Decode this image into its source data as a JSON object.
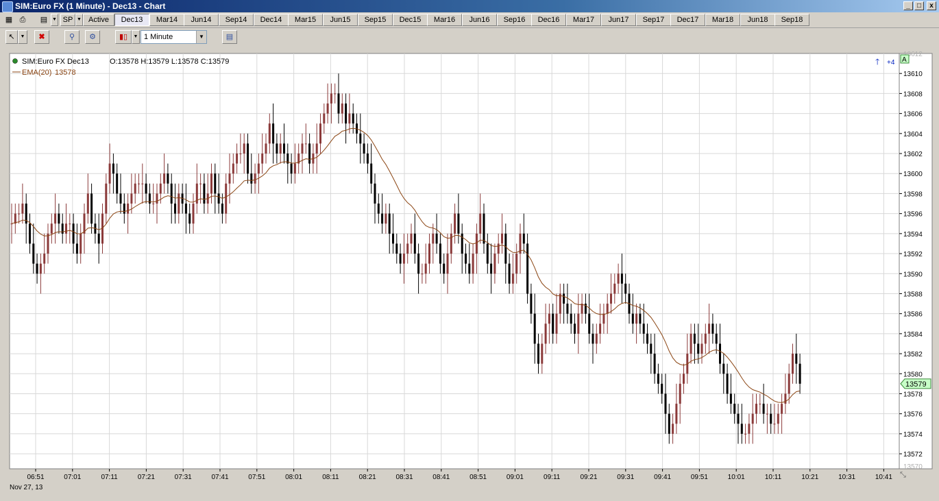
{
  "window": {
    "title": "SIM:Euro FX (1 Minute) - Dec13 - Chart",
    "minimize_glyph": "_",
    "maximize_glyph": "□",
    "close_glyph": "x"
  },
  "toolbar": {
    "instrument": "SP",
    "tabs": [
      "Active",
      "Dec13",
      "Mar14",
      "Jun14",
      "Sep14",
      "Dec14",
      "Mar15",
      "Jun15",
      "Sep15",
      "Dec15",
      "Mar16",
      "Jun16",
      "Sep16",
      "Dec16",
      "Mar17",
      "Jun17",
      "Sep17",
      "Dec17",
      "Mar18",
      "Jun18",
      "Sep18"
    ],
    "selected_tab": "Dec13",
    "timeframe": "1 Minute"
  },
  "colors": {
    "up_bar": "#8b3a3a",
    "down_bar": "#000000",
    "ema_line": "#8b4513",
    "grid": "#d8d8d8",
    "price_marker_bg": "#c8ffc8",
    "price_marker_border": "#3a8a3a"
  },
  "chart_data": {
    "type": "candlestick",
    "instrument_label": "SIM:Euro FX Dec13",
    "ohlc_label": "O:13578 H:13579 L:13578 C:13579",
    "indicator_label": "EMA(20)",
    "indicator_value": "13578",
    "last_price_label": "13579",
    "last_price": 13579,
    "scroll_label": "+4",
    "axis_button": "A",
    "date_label": "Nov 27, 13",
    "ylim": [
      13570.5,
      13612.0
    ],
    "ytick_values": [
      13572,
      13574,
      13576,
      13578,
      13580,
      13582,
      13584,
      13586,
      13588,
      13590,
      13592,
      13594,
      13596,
      13598,
      13600,
      13602,
      13604,
      13606,
      13608,
      13610
    ],
    "ytick_labels": [
      "13572",
      "13574",
      "13576",
      "13578",
      "13580",
      "13582",
      "13584",
      "13586",
      "13588",
      "13590",
      "13592",
      "13594",
      "13596",
      "13598",
      "13600",
      "13602",
      "13604",
      "13606",
      "13608",
      "13610"
    ],
    "ytick_top_label": "13612",
    "ytick_bottom_label": "13570",
    "xtick_labels": [
      "06:51",
      "07:01",
      "07:11",
      "07:21",
      "07:31",
      "07:41",
      "07:51",
      "08:01",
      "08:11",
      "08:21",
      "08:31",
      "08:41",
      "08:51",
      "09:01",
      "09:11",
      "09:21",
      "09:31",
      "09:41",
      "09:51",
      "10:01",
      "10:11",
      "10:21",
      "10:31",
      "10:41"
    ],
    "bar_count": 220,
    "closes": [
      13595,
      13596,
      13596,
      13597,
      13595,
      13593,
      13591,
      13590,
      13591,
      13592,
      13594,
      13595,
      13596,
      13595,
      13594,
      13595,
      13595,
      13593,
      13592,
      13594,
      13596,
      13598,
      13595,
      13594,
      13593,
      13596,
      13599,
      13601,
      13600,
      13598,
      13597,
      13596,
      13597,
      13598,
      13599,
      13599,
      13599,
      13598,
      13597,
      13597,
      13598,
      13599,
      13600,
      13599,
      13597,
      13596,
      13598,
      13597,
      13596,
      13595,
      13597,
      13599,
      13599,
      13597,
      13598,
      13600,
      13598,
      13597,
      13596,
      13599,
      13600,
      13601,
      13602,
      13602,
      13603,
      13600,
      13599,
      13600,
      13601,
      13602,
      13603,
      13605,
      13603,
      13602,
      13603,
      13602,
      13601,
      13600,
      13601,
      13602,
      13603,
      13603,
      13601,
      13602,
      13603,
      13605,
      13606,
      13607,
      13608,
      13608,
      13606,
      13607,
      13605,
      13606,
      13605,
      13604,
      13603,
      13602,
      13601,
      13599,
      13597,
      13596,
      13595,
      13596,
      13594,
      13593,
      13592,
      13591,
      13592,
      13593,
      13594,
      13592,
      13590,
      13590,
      13591,
      13593,
      13594,
      13593,
      13591,
      13590,
      13592,
      13594,
      13596,
      13594,
      13592,
      13591,
      13590,
      13592,
      13594,
      13596,
      13593,
      13591,
      13590,
      13592,
      13593,
      13594,
      13591,
      13589,
      13590,
      13592,
      13594,
      13593,
      13588,
      13586,
      13583,
      13581,
      13583,
      13585,
      13586,
      13584,
      13586,
      13588,
      13587,
      13586,
      13585,
      13584,
      13586,
      13587,
      13586,
      13584,
      13583,
      13584,
      13585,
      13586,
      13587,
      13588,
      13589,
      13590,
      13589,
      13588,
      13586,
      13585,
      13586,
      13585,
      13584,
      13583,
      13582,
      13580,
      13579,
      13578,
      13576,
      13574,
      13575,
      13577,
      13579,
      13580,
      13582,
      13584,
      13583,
      13582,
      13583,
      13584,
      13585,
      13584,
      13583,
      13581,
      13580,
      13578,
      13577,
      13576,
      13575,
      13574,
      13574,
      13575,
      13576,
      13577,
      13577,
      13576,
      13576,
      13575,
      13575,
      13576,
      13577,
      13578,
      13580,
      13582,
      13581,
      13579
    ]
  }
}
